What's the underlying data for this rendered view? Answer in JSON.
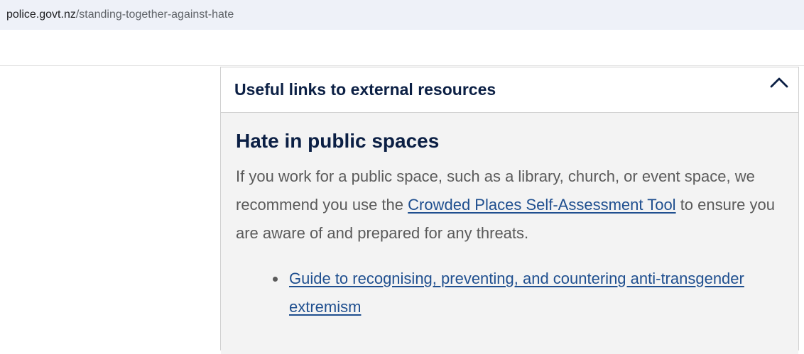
{
  "browser": {
    "url_domain": "police.govt.nz",
    "url_path": "/standing-together-against-hate"
  },
  "accordion": {
    "title": "Useful links to external resources",
    "toggle_icon": "chevron-up-icon",
    "expanded": true
  },
  "section": {
    "heading": "Hate in public spaces",
    "para_before_link": "If you work for a public space, such as a library, church, or event space, we recommend you use the ",
    "para_link": "Crowded Places Self-Assessment Tool",
    "para_after_link": " to ensure you are aware of and prepared for any threats.",
    "links": [
      {
        "label": "Guide to recognising, preventing, and countering anti-transgender extremism"
      }
    ]
  },
  "colors": {
    "heading": "#0b1f44",
    "link": "#1f4f8f",
    "body_text": "#5a5a5a",
    "panel_bg": "#f3f3f3",
    "url_bar_bg": "#eef1f8"
  }
}
